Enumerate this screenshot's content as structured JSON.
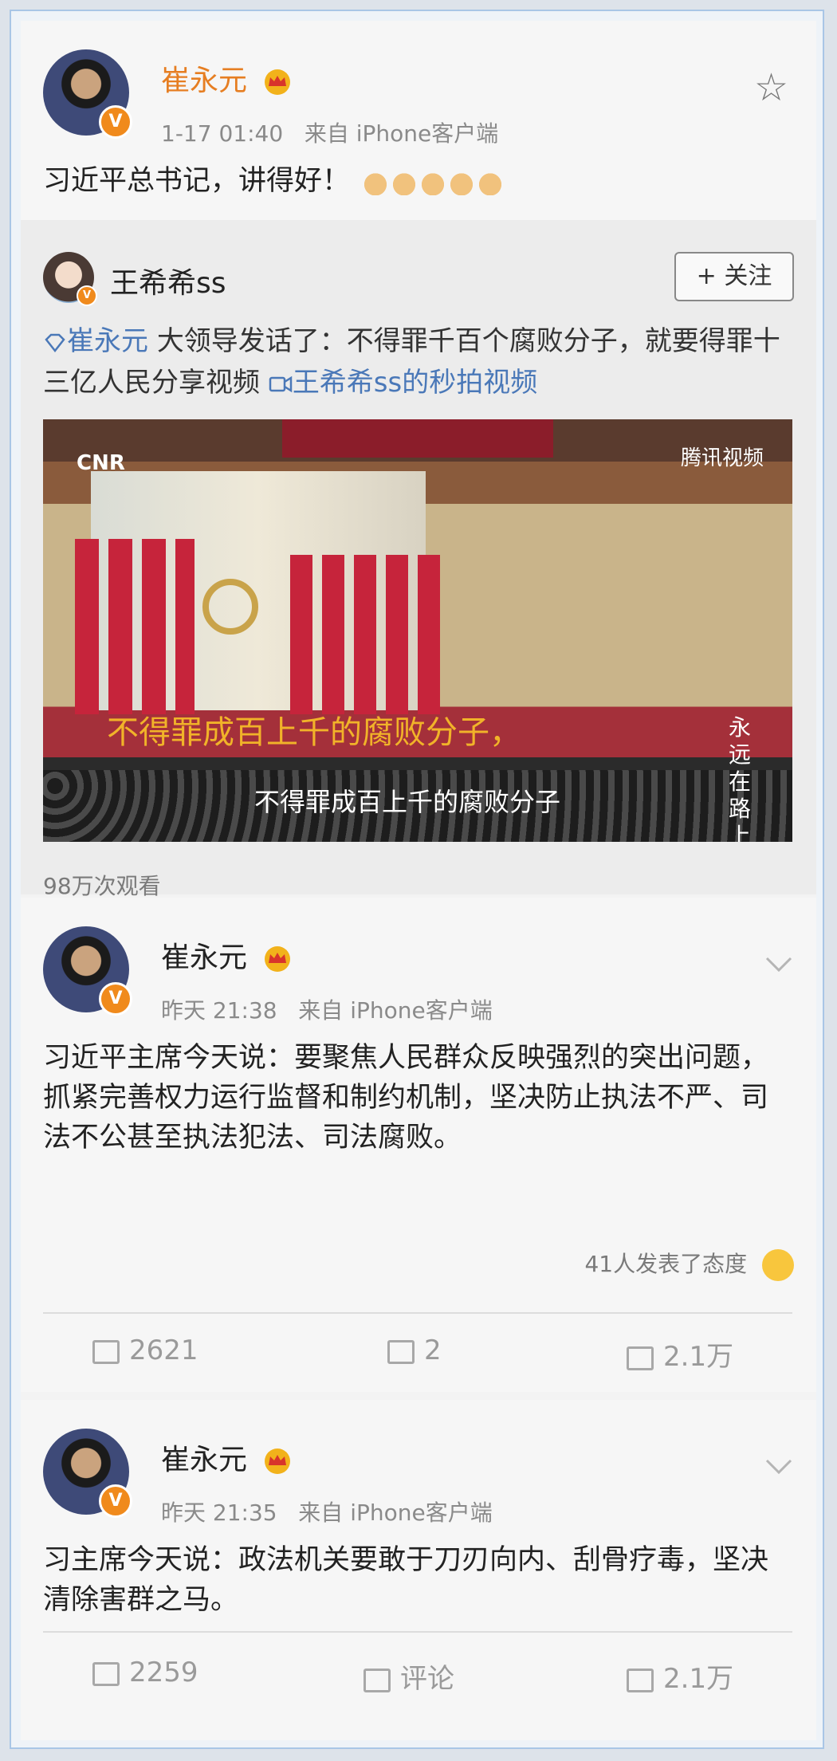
{
  "post1": {
    "author": "崔永元",
    "time": "1-17 01:40",
    "source": "来自 iPhone客户端",
    "text": "习近平总书记，讲得好！",
    "repost": {
      "author": "王希希ss",
      "follow_label": "+ 关注",
      "mention": "崔永元",
      "text": "大领导发话了：不得罪千百个腐败分子，就要得罪十三亿人民分享视频",
      "video_link": "王希希ss的秒拍视频",
      "video": {
        "logo_left": "CNR",
        "logo_right": "腾讯视频",
        "subtitle_big": "不得罪成百上千的腐败分子，",
        "subtitle_small": "不得罪成百上千的腐败分子",
        "side_text": "永远在路上"
      },
      "views": "98万次观看"
    }
  },
  "post2": {
    "author": "崔永元",
    "time": "昨天 21:38",
    "source": "来自 iPhone客户端",
    "text": "习近平主席今天说：要聚焦人民群众反映强烈的突出问题，抓紧完善权力运行监督和制约机制，坚决防止执法不严、司法不公甚至执法犯法、司法腐败。",
    "reactions": "41人发表了态度",
    "shares": "2621",
    "comments": "2",
    "likes": "2.1万"
  },
  "post3": {
    "author": "崔永元",
    "time": "昨天 21:35",
    "source": "来自 iPhone客户端",
    "text": "习主席今天说：政法机关要敢于刀刃向内、刮骨疗毒，坚决清除害群之马。",
    "shares": "2259",
    "comments": "评论",
    "likes": "2.1万"
  },
  "colors": {
    "author_orange": "#e67e22",
    "link_blue": "#4a78b8",
    "verified": "#f08a1c"
  }
}
